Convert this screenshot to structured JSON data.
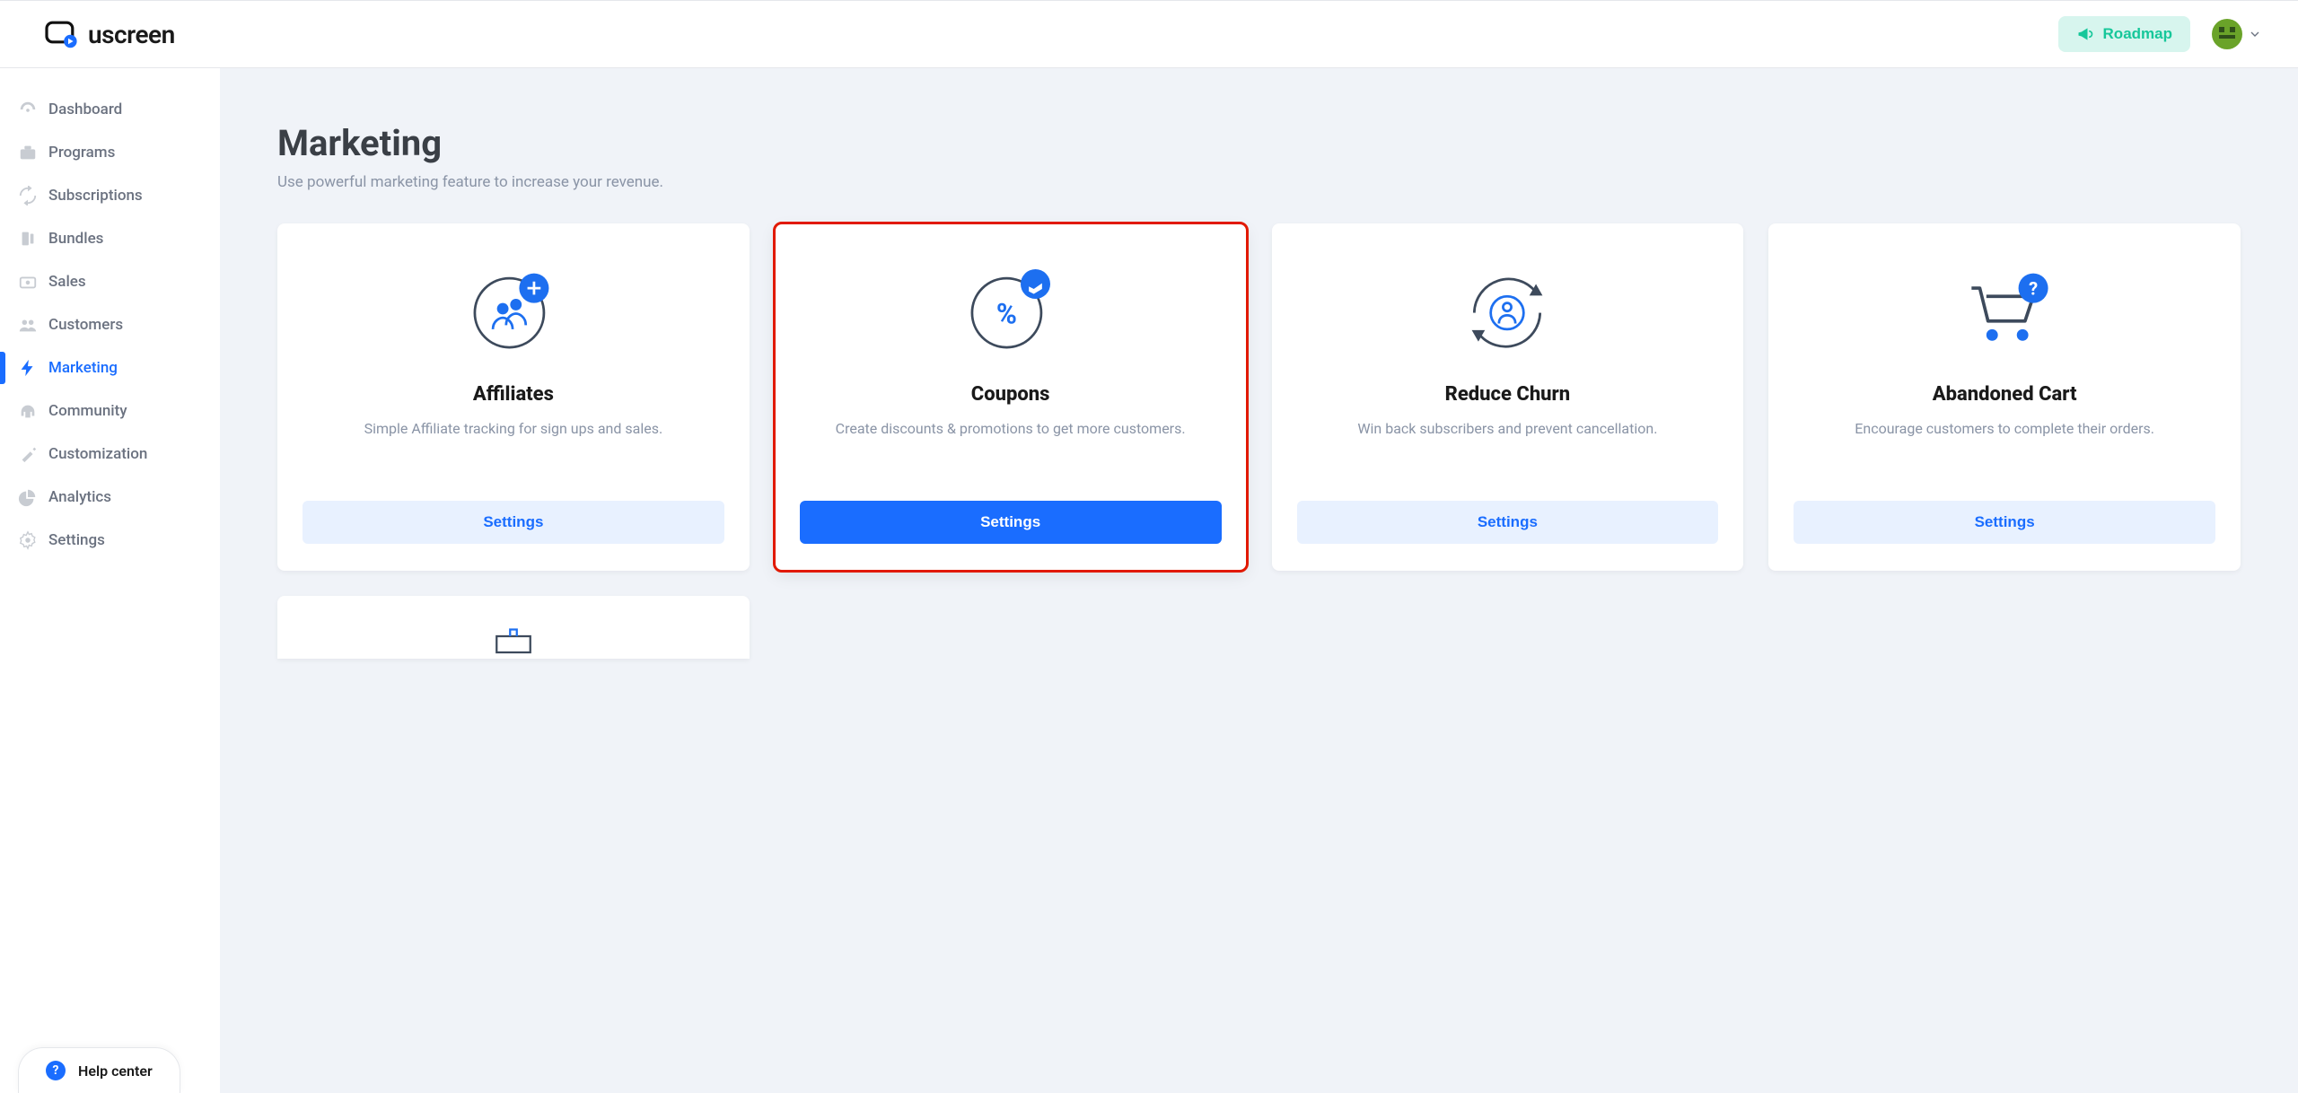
{
  "brand": "uscreen",
  "header": {
    "roadmap_label": "Roadmap"
  },
  "sidebar": {
    "items": [
      {
        "label": "Dashboard",
        "icon": "gauge-icon"
      },
      {
        "label": "Programs",
        "icon": "briefcase-icon"
      },
      {
        "label": "Subscriptions",
        "icon": "refresh-icon"
      },
      {
        "label": "Bundles",
        "icon": "stack-icon"
      },
      {
        "label": "Sales",
        "icon": "money-icon"
      },
      {
        "label": "Customers",
        "icon": "users-icon"
      },
      {
        "label": "Marketing",
        "icon": "bolt-icon",
        "active": true
      },
      {
        "label": "Community",
        "icon": "headset-icon"
      },
      {
        "label": "Customization",
        "icon": "magic-icon"
      },
      {
        "label": "Analytics",
        "icon": "pie-icon"
      },
      {
        "label": "Settings",
        "icon": "gear-icon"
      }
    ]
  },
  "help_center_label": "Help center",
  "page": {
    "title": "Marketing",
    "subtitle": "Use powerful marketing feature to increase your revenue."
  },
  "cards": [
    {
      "title": "Affiliates",
      "desc": "Simple Affiliate tracking for sign ups and sales.",
      "button_label": "Settings",
      "button_variant": "secondary",
      "icon": "affiliates-illustration",
      "highlighted": false
    },
    {
      "title": "Coupons",
      "desc": "Create discounts & promotions to get more customers.",
      "button_label": "Settings",
      "button_variant": "primary",
      "icon": "coupons-illustration",
      "highlighted": true
    },
    {
      "title": "Reduce Churn",
      "desc": "Win back subscribers and prevent cancellation.",
      "button_label": "Settings",
      "button_variant": "secondary",
      "icon": "churn-illustration",
      "highlighted": false
    },
    {
      "title": "Abandoned Cart",
      "desc": "Encourage customers to complete their orders.",
      "button_label": "Settings",
      "button_variant": "secondary",
      "icon": "cart-illustration",
      "highlighted": false
    }
  ]
}
